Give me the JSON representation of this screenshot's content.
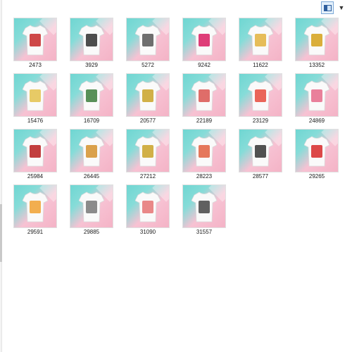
{
  "window": {
    "view_mode": "large-icons",
    "icons": {
      "view": "large-icons-view-icon",
      "options": "chevron-down-icon"
    }
  },
  "files": [
    {
      "name": "2473",
      "accent": "#c62828"
    },
    {
      "name": "3929",
      "accent": "#2e2e2e"
    },
    {
      "name": "5272",
      "accent": "#555555"
    },
    {
      "name": "9242",
      "accent": "#d81b60"
    },
    {
      "name": "11622",
      "accent": "#e2b13c"
    },
    {
      "name": "13352",
      "accent": "#d4a017"
    },
    {
      "name": "15476",
      "accent": "#e3c14b"
    },
    {
      "name": "16709",
      "accent": "#3b7d3b"
    },
    {
      "name": "20577",
      "accent": "#c9a227"
    },
    {
      "name": "22189",
      "accent": "#d9534f"
    },
    {
      "name": "23129",
      "accent": "#e64a3c"
    },
    {
      "name": "24869",
      "accent": "#e56a8a"
    },
    {
      "name": "25984",
      "accent": "#b71c1c"
    },
    {
      "name": "26445",
      "accent": "#d4902b"
    },
    {
      "name": "27212",
      "accent": "#c9a227"
    },
    {
      "name": "28223",
      "accent": "#e06040"
    },
    {
      "name": "28577",
      "accent": "#333333"
    },
    {
      "name": "29265",
      "accent": "#d62828"
    },
    {
      "name": "29591",
      "accent": "#f0a030"
    },
    {
      "name": "29885",
      "accent": "#777777"
    },
    {
      "name": "31090",
      "accent": "#e57373"
    },
    {
      "name": "31557",
      "accent": "#444444"
    }
  ]
}
